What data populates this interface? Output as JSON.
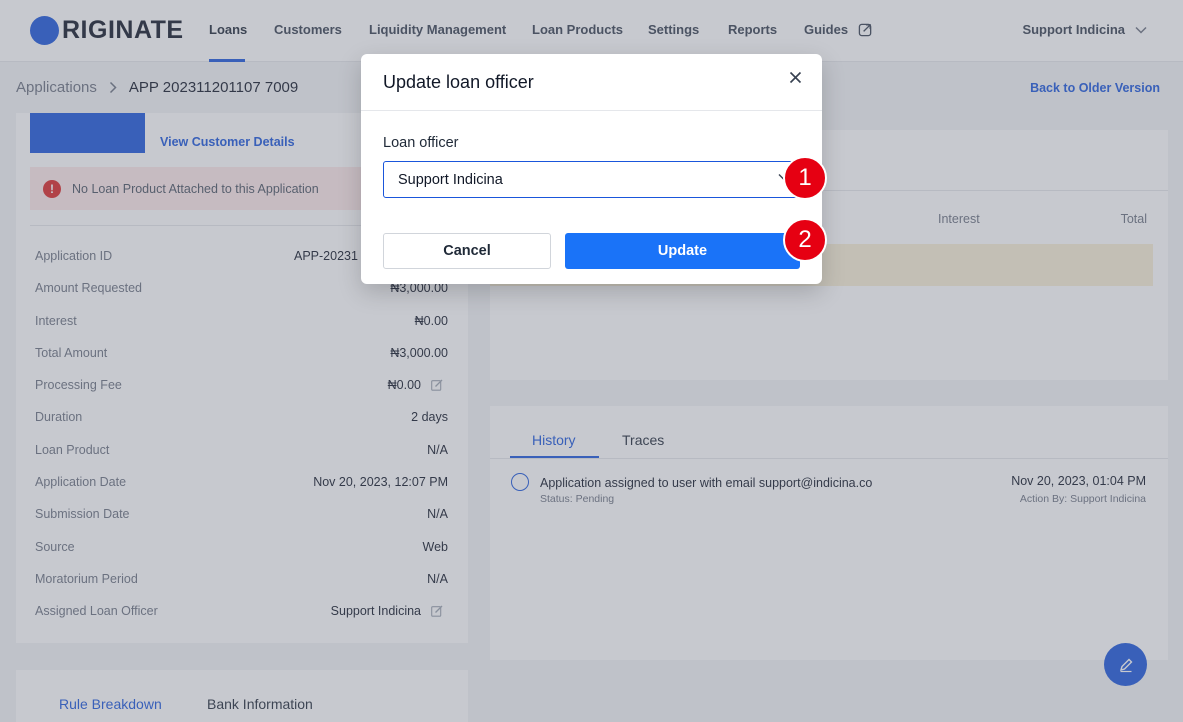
{
  "nav": {
    "logo_text": "RIGINATE",
    "items": [
      "Loans",
      "Customers",
      "Liquidity Management",
      "Loan Products",
      "Settings",
      "Reports",
      "Guides"
    ],
    "user": "Support Indicina"
  },
  "breadcrumb": {
    "parent": "Applications",
    "current": "APP 202311201107 7009"
  },
  "back_link": "Back to Older Version",
  "left": {
    "view_customer": "View Customer Details",
    "alert": "No Loan Product Attached to this Application",
    "details": [
      {
        "label": "Application ID",
        "value": "APP-20231"
      },
      {
        "label": "Amount Requested",
        "value": "₦3,000.00"
      },
      {
        "label": "Interest",
        "value": "₦0.00"
      },
      {
        "label": "Total Amount",
        "value": "₦3,000.00"
      },
      {
        "label": "Processing Fee",
        "value": "₦0.00"
      },
      {
        "label": "Duration",
        "value": "2 days"
      },
      {
        "label": "Loan Product",
        "value": "N/A"
      },
      {
        "label": "Application Date",
        "value": "Nov 20, 2023, 12:07 PM"
      },
      {
        "label": "Submission Date",
        "value": "N/A"
      },
      {
        "label": "Source",
        "value": "Web"
      },
      {
        "label": "Moratorium Period",
        "value": "N/A"
      },
      {
        "label": "Assigned Loan Officer",
        "value": "Support Indicina"
      }
    ],
    "bottom_tabs": [
      "Rule Breakdown",
      "Bank Information"
    ]
  },
  "right": {
    "columns": [
      "Interest",
      "Total"
    ],
    "tabs": [
      "History",
      "Traces"
    ],
    "history": {
      "text": "Application assigned to user with email support@indicina.co",
      "status": "Status: Pending",
      "date": "Nov 20, 2023, 01:04 PM",
      "by": "Action By: Support Indicina"
    }
  },
  "modal": {
    "title": "Update loan officer",
    "field_label": "Loan officer",
    "selected_value": "Support Indicina",
    "cancel_label": "Cancel",
    "update_label": "Update"
  },
  "markers": [
    "1",
    "2"
  ],
  "colors": {
    "accent": "#1a56db",
    "update_button": "#1a73f8",
    "alert_bg": "#fde8e8",
    "marker": "#e60012"
  }
}
